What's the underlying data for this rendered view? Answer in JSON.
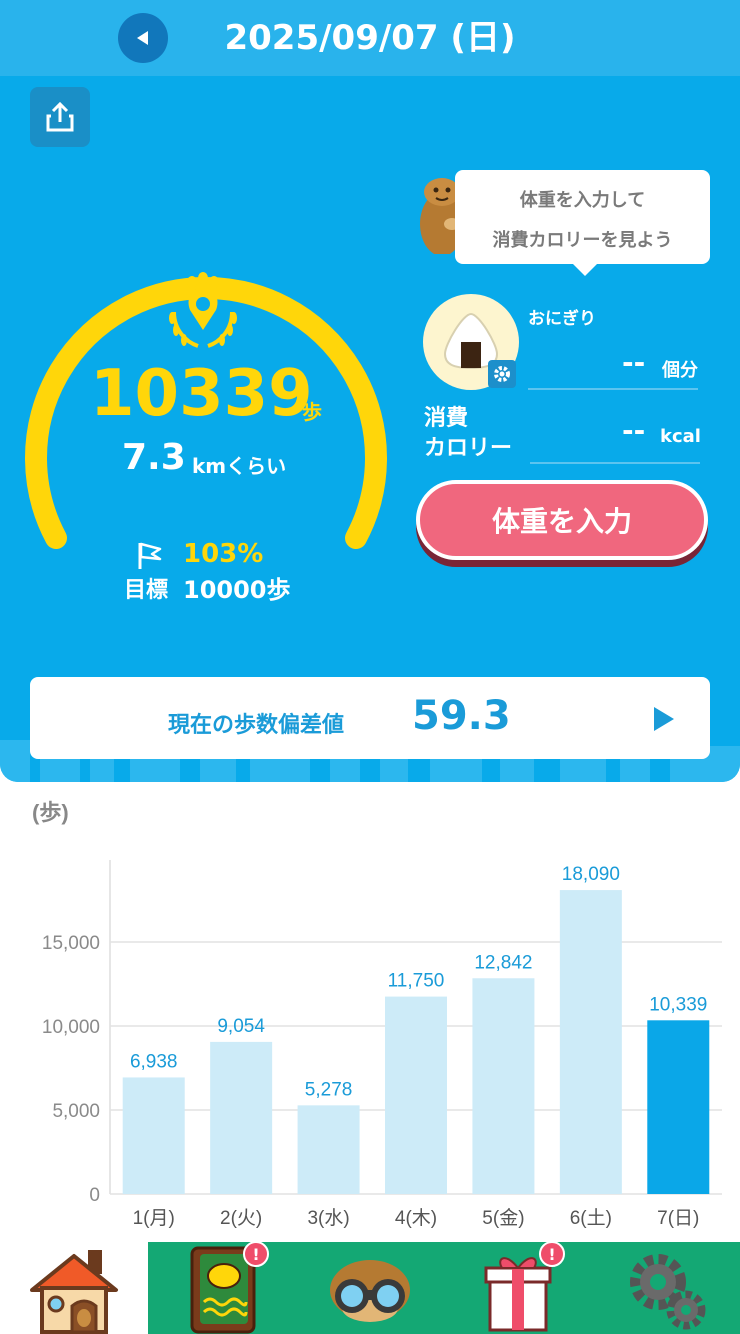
{
  "header": {
    "title": "2025/09/07 (日)"
  },
  "icons": {
    "back": "triangle-left-icon",
    "share": "share-icon",
    "footprint": "footprint-laurel-icon",
    "flag": "flag-icon",
    "gear": "gear-icon",
    "arrow": "play-arrow-icon"
  },
  "summary": {
    "steps": "10339",
    "steps_unit": "歩",
    "distance": "7.3",
    "distance_unit": "kmくらい",
    "goal_percent": "103%",
    "goal_label": "目標",
    "goal_value": "10000歩",
    "goal_fraction": 1.0339
  },
  "bubble": {
    "line1": "体重を入力して",
    "line2": "消費カロリーを見よう"
  },
  "food": {
    "name": "おにぎり",
    "value": "--",
    "unit": "個分"
  },
  "calorie": {
    "label_line1": "消費",
    "label_line2": "カロリー",
    "value": "--",
    "unit": "kcal"
  },
  "weight_button": {
    "label": "体重を入力"
  },
  "deviation": {
    "label": "現在の歩数偏差値",
    "value": "59.3"
  },
  "colors": {
    "header": "#29b3ec",
    "panel": "#08aaea",
    "accent_yellow": "#ffd60a",
    "button_pink": "#f0677e",
    "bar_light": "#cdebf8",
    "bar_current": "#0aa7e8",
    "nav_green": "#14a874"
  },
  "chart_data": {
    "type": "bar",
    "ylabel": "(歩)",
    "categories": [
      "1(月)",
      "2(火)",
      "3(水)",
      "4(木)",
      "5(金)",
      "6(土)",
      "7(日)"
    ],
    "values": [
      6938,
      9054,
      5278,
      11750,
      12842,
      18090,
      10339
    ],
    "value_labels": [
      "6,938",
      "9,054",
      "5,278",
      "11,750",
      "12,842",
      "18,090",
      "10,339"
    ],
    "yticks": [
      0,
      5000,
      10000,
      15000
    ],
    "ytick_labels": [
      "0",
      "5,000",
      "10,000",
      "15,000"
    ],
    "ylim": [
      0,
      20000
    ],
    "highlight_index": 6,
    "grid": true
  },
  "nav": {
    "items": [
      {
        "name": "home",
        "icon": "house-icon",
        "badge": ""
      },
      {
        "name": "diary",
        "icon": "notebook-icon",
        "badge": "!"
      },
      {
        "name": "explore",
        "icon": "binoculars-icon",
        "badge": ""
      },
      {
        "name": "gift",
        "icon": "gift-icon",
        "badge": "!"
      },
      {
        "name": "settings",
        "icon": "gears-icon",
        "badge": ""
      }
    ]
  }
}
